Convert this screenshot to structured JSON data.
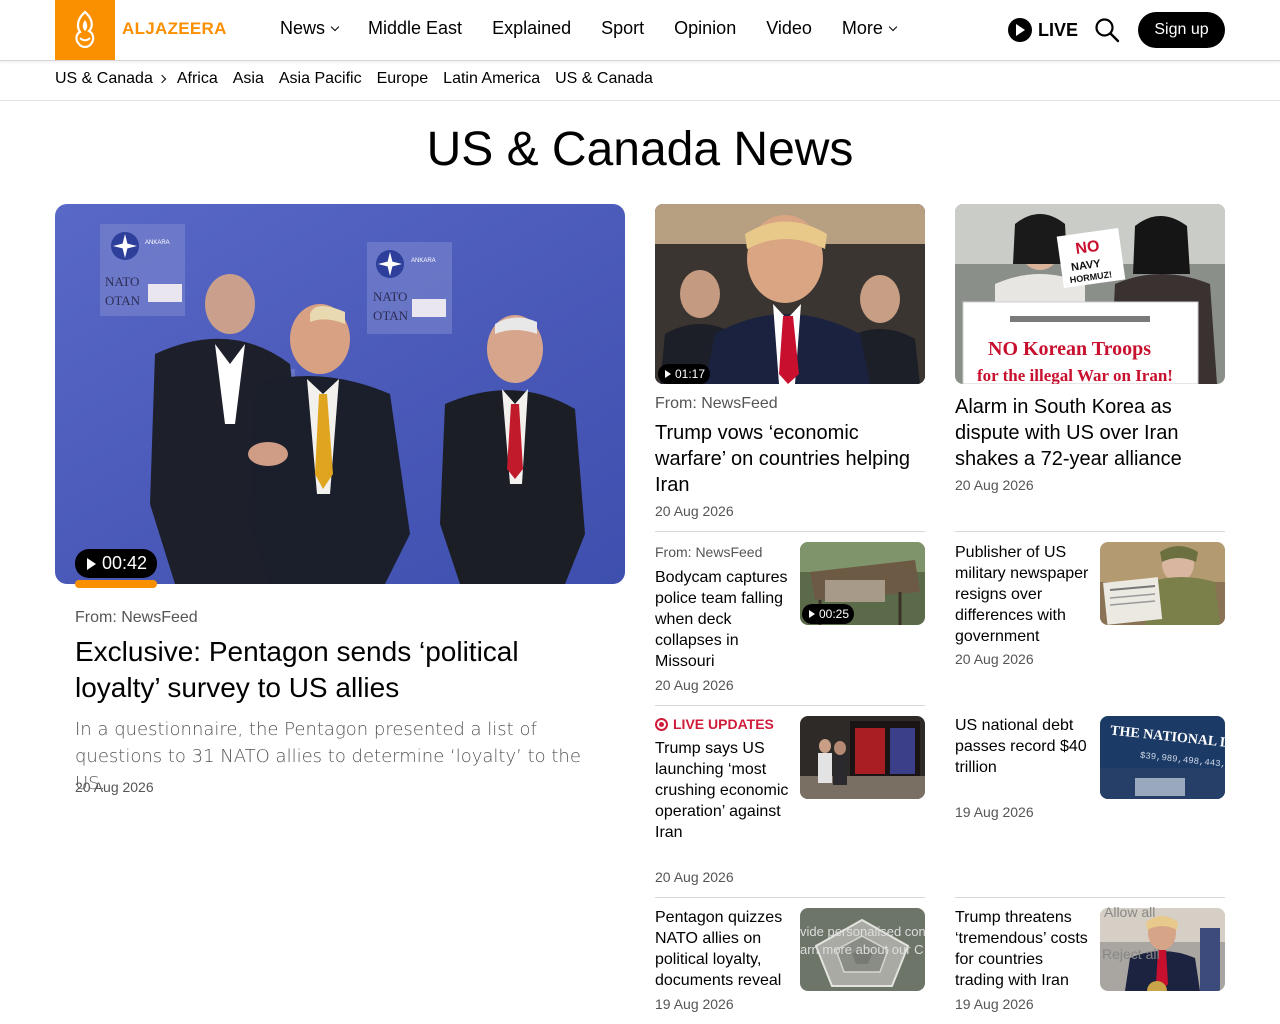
{
  "brand": {
    "name": "ALJAZEERA",
    "color": "#fa9000"
  },
  "nav": {
    "items": [
      {
        "label": "News",
        "dropdown": true
      },
      {
        "label": "Middle East",
        "dropdown": false
      },
      {
        "label": "Explained",
        "dropdown": false
      },
      {
        "label": "Sport",
        "dropdown": false
      },
      {
        "label": "Opinion",
        "dropdown": false
      },
      {
        "label": "Video",
        "dropdown": false
      },
      {
        "label": "More",
        "dropdown": true
      }
    ],
    "live_label": "LIVE",
    "signup_label": "Sign up"
  },
  "subnav": {
    "current": "US & Canada",
    "links": [
      "Africa",
      "Asia",
      "Asia Pacific",
      "Europe",
      "Latin America",
      "US & Canada"
    ]
  },
  "page_title": "US & Canada News",
  "hero": {
    "duration": "00:42",
    "source": "From: NewsFeed",
    "title": "Exclusive: Pentagon sends ‘political loyalty’ survey to US allies",
    "summary": "In a questionnaire, the Pentagon presented a list of questions to 31 NATO allies to determine ‘loyalty’ to the US.",
    "date": "20 Aug 2026",
    "image_text": {
      "flag_a": "NATO",
      "flag_b": "OTAN",
      "banner": "ANKARA"
    }
  },
  "col_cards": [
    {
      "duration": "01:17",
      "source": "From: NewsFeed",
      "title": "Trump vows ‘economic warfare’ on countries helping Iran",
      "date": "20 Aug 2026"
    },
    {
      "title": "Alarm in South Korea as dispute with US over Iran shakes a 72-year alliance",
      "date": "20 Aug 2026",
      "sign_lines": [
        "NO",
        "NAVY",
        "HORMUZ!",
        "NO Korean Troops",
        "for the illegal War on Iran!"
      ]
    }
  ],
  "small_left": [
    {
      "source": "From: NewsFeed",
      "title": "Bodycam captures police team falling when deck collapses in Missouri",
      "date": "20 Aug 2026",
      "duration": "00:25"
    },
    {
      "live": "LIVE UPDATES",
      "title": "Trump says US launching ‘most crushing economic operation’ against Iran",
      "date": "20 Aug 2026"
    },
    {
      "title": "Pentagon quizzes NATO allies on political loyalty, documents reveal",
      "date": "19 Aug 2026"
    }
  ],
  "small_right": [
    {
      "title": "Publisher of US military newspaper resigns over differences with government",
      "date": "20 Aug 2026"
    },
    {
      "title": "US national debt passes record $40 trillion",
      "date": "19 Aug 2026",
      "image_text": "THE NATIONAL DEBT",
      "image_number": "$39,989,498,443,76"
    },
    {
      "title": "Trump threatens ‘tremendous’ costs for countries trading with Iran",
      "date": "19 Aug 2026"
    }
  ],
  "consent": {
    "allow": "Allow all",
    "reject": "Reject all",
    "line1": "vide personalised con",
    "line2": "arn more about our C"
  }
}
